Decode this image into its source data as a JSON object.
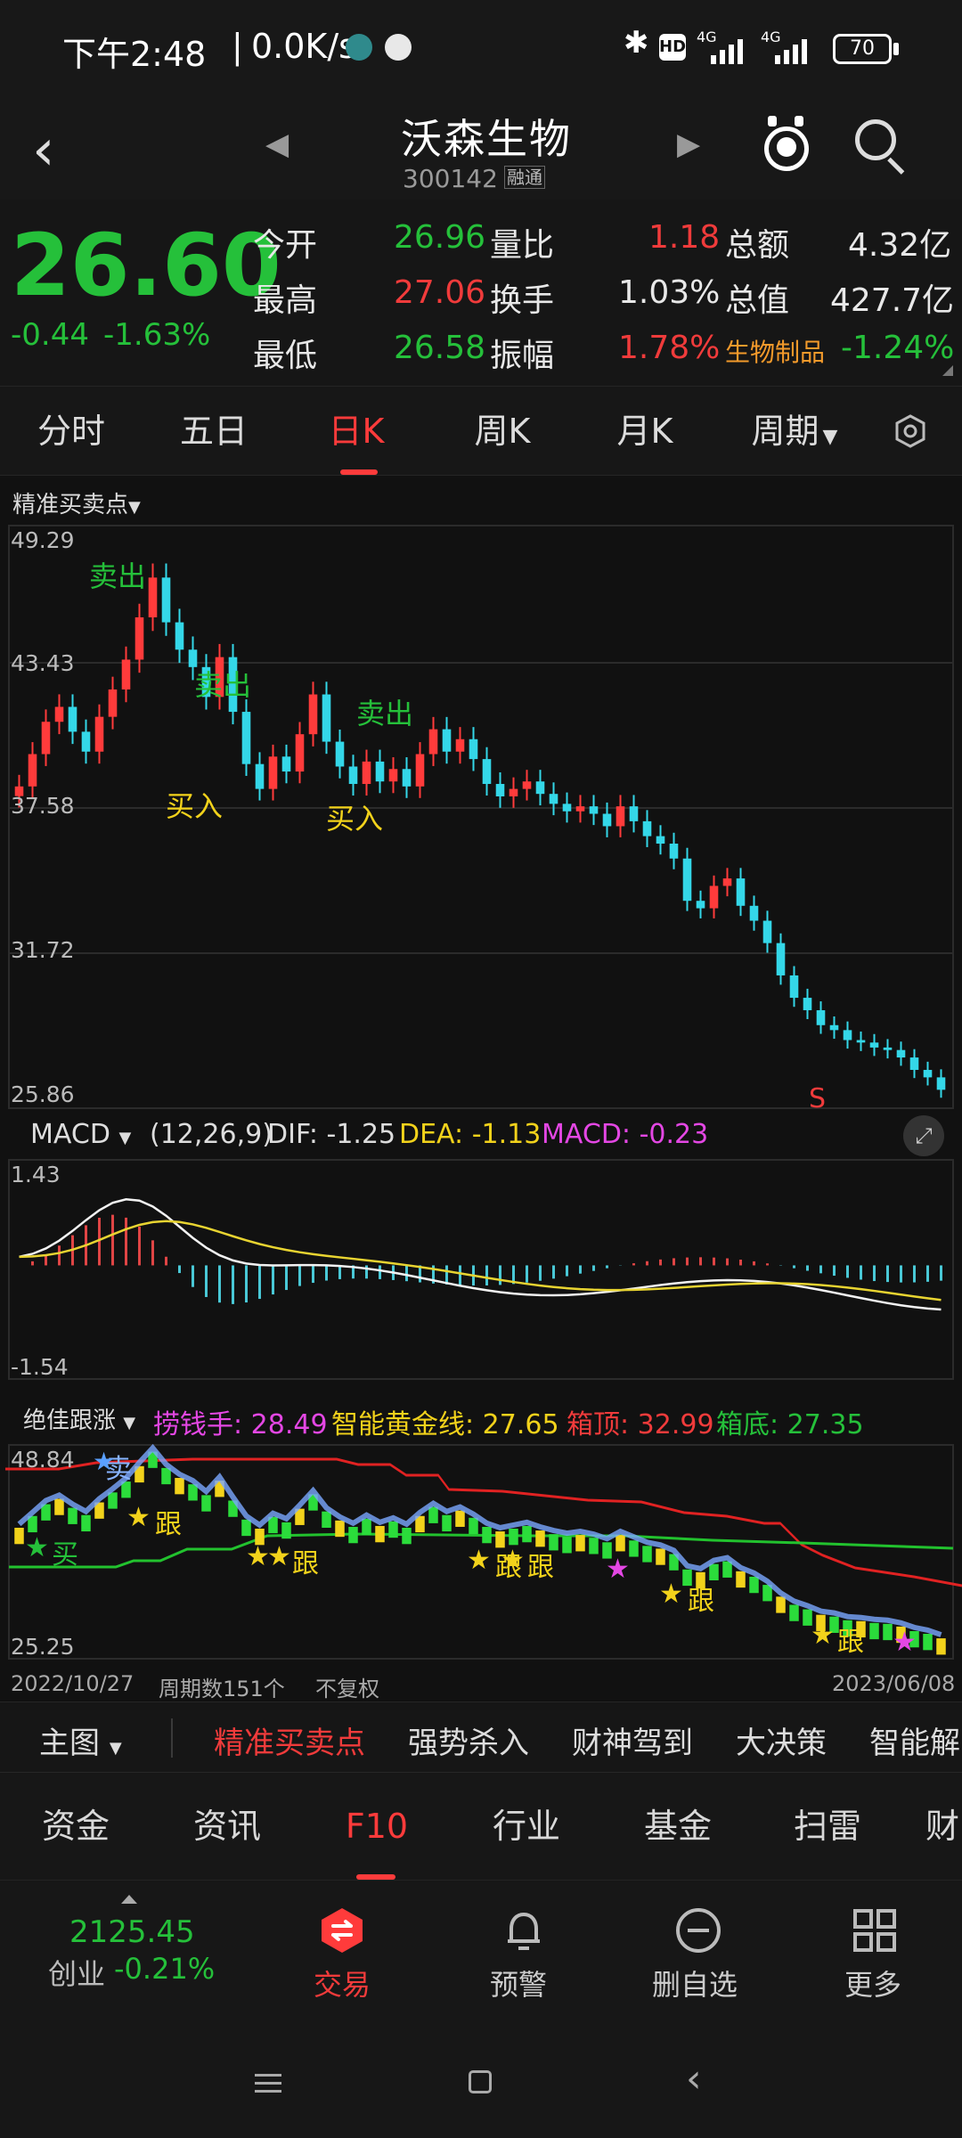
{
  "status": {
    "time": "下午2:48",
    "net": "0.0K/s",
    "battery": "70",
    "signal1": "4G",
    "signal2": "4G",
    "hd": "HD"
  },
  "title": {
    "name": "沃森生物",
    "code": "300142",
    "badge": "融通"
  },
  "quote": {
    "price": "26.60",
    "change": "-0.44",
    "change_pct": "-1.63%",
    "fields": [
      {
        "label": "今开",
        "value": "26.96",
        "label2": "量比",
        "value2": "1.18",
        "label3": "总额",
        "value3": "4.32亿"
      },
      {
        "label": "最高",
        "value": "27.06",
        "label2": "换手",
        "value2": "1.03%",
        "label3": "总值",
        "value3": "427.7亿"
      },
      {
        "label": "最低",
        "value": "26.58",
        "label2": "振幅",
        "value2": "1.78%",
        "label3": "生物制品",
        "value3": "-1.24%"
      }
    ]
  },
  "tabs": {
    "items": [
      "分时",
      "五日",
      "日K",
      "周K",
      "月K",
      "周期"
    ],
    "active": "日K"
  },
  "main_chart": {
    "selector": "精准买卖点",
    "axis_ticks": [
      "49.29",
      "43.43",
      "37.58",
      "31.72",
      "25.86"
    ],
    "signals": {
      "sell": "卖出",
      "buy": "买入",
      "s": "S"
    }
  },
  "macd": {
    "name": "MACD",
    "params": "(12,26,9)",
    "dif": "DIF: -1.25",
    "dea": "DEA: -1.13",
    "macd": "MACD: -0.23",
    "top": "1.43",
    "bottom": "-1.54"
  },
  "indicator": {
    "name": "绝佳跟涨",
    "l1": "捞钱手: 28.49",
    "l2": "智能黄金线: 27.65",
    "l3": "箱顶: 32.99",
    "l4": "箱底: 27.35",
    "top": "48.84",
    "bottom": "25.25",
    "buy": "买",
    "sell": "卖",
    "follow": "跟"
  },
  "footer_axis": {
    "start": "2022/10/27",
    "count": "周期数151个",
    "adjust": "不复权",
    "end": "2023/06/08"
  },
  "strategy": {
    "main": "主图",
    "items": [
      "精准买卖点",
      "强势杀入",
      "财神驾到",
      "大决策",
      "智能解"
    ]
  },
  "bottom_tabs": {
    "items": [
      "资金",
      "资讯",
      "F10",
      "行业",
      "基金",
      "扫雷",
      "财"
    ],
    "active": "F10"
  },
  "dock": {
    "index_value": "2125.45",
    "index_name": "创业",
    "index_change": "-0.21%",
    "trade": "交易",
    "alert": "预警",
    "remove": "删自选",
    "more": "更多"
  },
  "chart_data": {
    "type": "candlestick",
    "title": "沃森生物 日K",
    "ylim": [
      25.86,
      49.29
    ],
    "x_start": "2022/10/27",
    "x_end": "2023/06/08",
    "periods": 151,
    "approx_closes": [
      38.8,
      40.1,
      41.4,
      42.0,
      41.0,
      40.2,
      41.6,
      42.7,
      43.9,
      45.6,
      47.2,
      45.4,
      44.3,
      43.6,
      42.4,
      44.0,
      41.8,
      39.7,
      38.7,
      40.0,
      39.4,
      40.9,
      42.5,
      40.6,
      39.6,
      38.9,
      39.8,
      39.0,
      39.5,
      38.8,
      40.1,
      41.1,
      40.2,
      40.7,
      39.9,
      38.9,
      38.4,
      38.7,
      39.0,
      38.5,
      38.1,
      37.8,
      38.0,
      37.7,
      37.2,
      38.0,
      37.4,
      36.8,
      36.5,
      35.9,
      34.2,
      33.9,
      34.8,
      35.1,
      34.0,
      33.4,
      32.5,
      31.2,
      30.3,
      29.8,
      29.2,
      29.0,
      28.6,
      28.5,
      28.3,
      28.2,
      27.9,
      27.4,
      27.1,
      26.6
    ],
    "macd_range": [
      -1.54,
      1.43
    ],
    "indicator_range": [
      25.25,
      48.84
    ]
  }
}
